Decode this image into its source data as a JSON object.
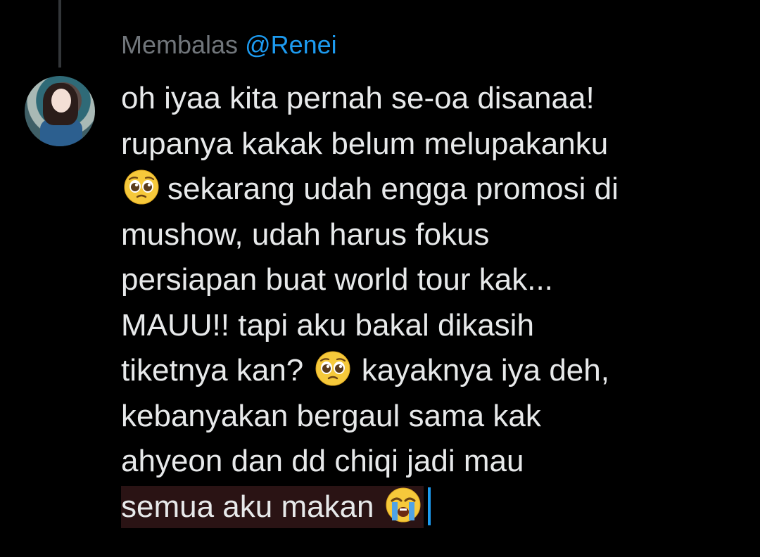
{
  "reply": {
    "prefix": "Membalas",
    "mention": "@Renei"
  },
  "tweet": {
    "line1": "oh iyaa kita pernah se-oa disanaa!",
    "line2": "rupanya kakak belum melupakanku",
    "line3_text": "sekarang udah engga promosi di",
    "line4": "mushow, udah harus fokus",
    "line5": "persiapan buat world tour kak...",
    "line6": "MAUU!! tapi aku bakal dikasih",
    "line7_before": "tiketnya kan?",
    "line7_after": "kayaknya iya deh,",
    "line8": "kebanyakan bergaul sama kak",
    "line9": "ahyeon dan dd chiqi jadi mau",
    "line10_text": "semua aku makan"
  },
  "icons": {
    "pleading": "pleading-face-emoji",
    "crying": "loudly-crying-face-emoji"
  },
  "colors": {
    "background": "#000000",
    "text": "#e7e9ea",
    "muted": "#71767b",
    "accent": "#1d9bf0",
    "highlight": "#2a1314"
  }
}
